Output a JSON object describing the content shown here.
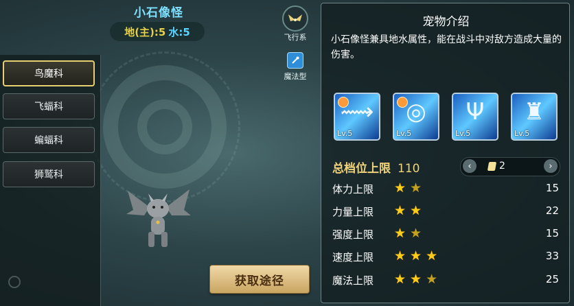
{
  "pet": {
    "name": "小石像怪",
    "attr_earth": "地(主):5",
    "attr_water": "水:5"
  },
  "badges": {
    "type1": "飞行系",
    "type2": "魔法型"
  },
  "sidebar": {
    "items": [
      {
        "label": "鸟魔科",
        "active": true
      },
      {
        "label": "飞蝠科",
        "active": false
      },
      {
        "label": "蝙蝠科",
        "active": false
      },
      {
        "label": "狮鹫科",
        "active": false
      }
    ]
  },
  "get_button": "获取途径",
  "panel": {
    "intro_title": "宠物介绍",
    "intro_text": "小石像怪兼具地水属性，能在战斗中对敌方造成大量的伤害。",
    "skills": [
      {
        "level": "Lv.5",
        "icon": "sword-skill-icon"
      },
      {
        "level": "Lv.5",
        "icon": "vortex-skill-icon"
      },
      {
        "level": "Lv.5",
        "icon": "rune-skill-icon"
      },
      {
        "level": "Lv.5",
        "icon": "wizard-skill-icon"
      }
    ],
    "total_label": "总档位上限",
    "total_value": "110",
    "pager_value": "2",
    "stats": [
      {
        "label": "体力上限",
        "stars": 1.5,
        "value": "15"
      },
      {
        "label": "力量上限",
        "stars": 2,
        "value": "22"
      },
      {
        "label": "强度上限",
        "stars": 1.5,
        "value": "15"
      },
      {
        "label": "速度上限",
        "stars": 3,
        "value": "33"
      },
      {
        "label": "魔法上限",
        "stars": 2.5,
        "value": "25"
      }
    ]
  },
  "colors": {
    "accent_gold": "#f1d47a",
    "star": "#ffcc1a",
    "name_blue": "#7fe0ff"
  }
}
